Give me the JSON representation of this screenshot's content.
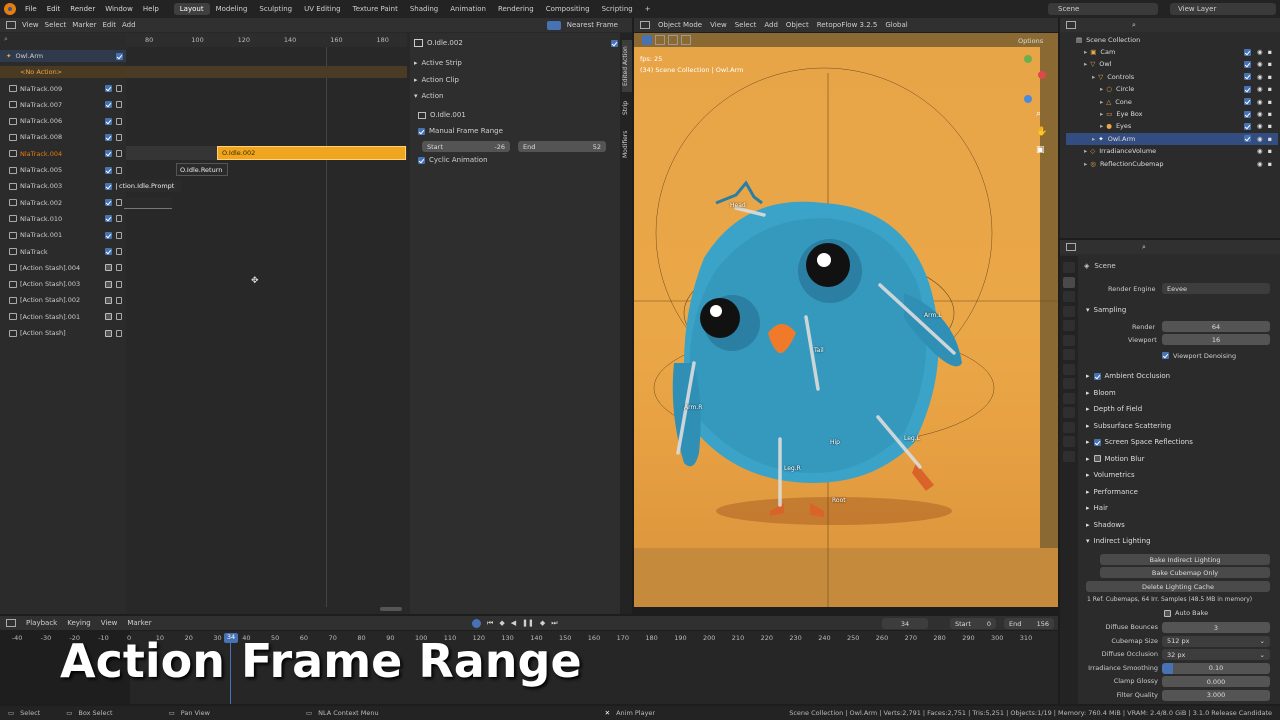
{
  "menu": {
    "file": "File",
    "edit": "Edit",
    "render": "Render",
    "window": "Window",
    "help": "Help"
  },
  "workspaces": [
    "Layout",
    "Modeling",
    "Sculpting",
    "UV Editing",
    "Texture Paint",
    "Shading",
    "Animation",
    "Rendering",
    "Compositing",
    "Scripting",
    "+"
  ],
  "scene_field": "Scene",
  "view_layer_field": "View Layer",
  "nla": {
    "header": {
      "view": "View",
      "select": "Select",
      "marker": "Marker",
      "edit": "Edit",
      "add": "Add",
      "snap": "Nearest Frame"
    },
    "ruler": [
      "80",
      "100",
      "120",
      "140",
      "160",
      "180"
    ],
    "object": "Owl.Arm",
    "no_action": "<No Action>",
    "tracks": [
      "NlaTrack.009",
      "NlaTrack.007",
      "NlaTrack.006",
      "NlaTrack.008",
      "NlaTrack.004",
      "NlaTrack.005",
      "NlaTrack.003",
      "NlaTrack.002",
      "NlaTrack.010",
      "NlaTrack.001",
      "NlaTrack",
      "[Action Stash].004",
      "[Action Stash].003",
      "[Action Stash].002",
      "[Action Stash].001",
      "[Action Stash]"
    ],
    "strips": {
      "active": "O.Idle.002",
      "return": "O.Idle.Return",
      "prompt": "ction.Idle.Prompt"
    }
  },
  "sidebar": {
    "title": "O.Idle.002",
    "active_strip": "Active Strip",
    "action_clip": "Action Clip",
    "action": "Action",
    "action_name": "O.Idle.001",
    "manual_range": "Manual Frame Range",
    "start_label": "Start",
    "start_value": "-26",
    "end_label": "End",
    "end_value": "52",
    "cyclic": "Cyclic Animation",
    "tabs": [
      "Edited Action",
      "Strip",
      "Modifiers"
    ]
  },
  "viewport": {
    "mode": "Object Mode",
    "view": "View",
    "select": "Select",
    "add": "Add",
    "object": "Object",
    "addon": "RetopoFlow 3.2.5",
    "orientation": "Global",
    "options": "Options",
    "fps": "fps: 25",
    "collection": "(34) Scene Collection | Owl.Arm",
    "bones": [
      "Head",
      "Arm.L",
      "Tail",
      "Arm.R",
      "Hip",
      "Leg.L",
      "Leg.R",
      "Root"
    ]
  },
  "outliner": {
    "header": "Scene Collection",
    "items": [
      "Cam",
      "Owl",
      "Controls",
      "Circle",
      "Cone",
      "Eye Box",
      "Eyes",
      "Owl.Arm",
      "IrradianceVolume",
      "ReflectionCubemap"
    ]
  },
  "properties": {
    "scene": "Scene",
    "render_engine_label": "Render Engine",
    "render_engine": "Eevee",
    "sampling": "Sampling",
    "render_label": "Render",
    "render_value": "64",
    "viewport_label": "Viewport",
    "viewport_value": "16",
    "viewport_denoising": "Viewport Denoising",
    "sections": [
      "Ambient Occlusion",
      "Bloom",
      "Depth of Field",
      "Subsurface Scattering",
      "Screen Space Reflections",
      "Motion Blur",
      "Volumetrics",
      "Performance",
      "Hair",
      "Shadows",
      "Indirect Lighting"
    ],
    "bake_indirect": "Bake Indirect Lighting",
    "bake_cubemap": "Bake Cubemap Only",
    "delete_cache": "Delete Lighting Cache",
    "cache_info": "1 Ref. Cubemaps, 64 Irr. Samples (48.5 MB in memory)",
    "auto_bake": "Auto Bake",
    "diffuse_bounces_label": "Diffuse Bounces",
    "diffuse_bounces": "3",
    "cubemap_size_label": "Cubemap Size",
    "cubemap_size": "512 px",
    "diffuse_occlusion_label": "Diffuse Occlusion",
    "diffuse_occlusion": "32 px",
    "irradiance_smoothing_label": "Irradiance Smoothing",
    "irradiance_smoothing": "0.10",
    "clamp_glossy_label": "Clamp Glossy",
    "clamp_glossy": "0.000",
    "filter_quality_label": "Filter Quality",
    "filter_quality": "3.000"
  },
  "timeline": {
    "playback": "Playback",
    "keying": "Keying",
    "view": "View",
    "marker": "Marker",
    "current": "34",
    "start_label": "Start",
    "start": "0",
    "end_label": "End",
    "end": "156",
    "ticks": [
      "-40",
      "-30",
      "-20",
      "-10",
      "0",
      "10",
      "20",
      "30",
      "34",
      "40",
      "50",
      "60",
      "70",
      "80",
      "90",
      "100",
      "110",
      "120",
      "130",
      "140",
      "150",
      "160",
      "170",
      "180",
      "190",
      "200",
      "210",
      "220",
      "230",
      "240",
      "250",
      "260",
      "270",
      "280",
      "290",
      "300",
      "310"
    ]
  },
  "caption": "Action Frame Range",
  "status": {
    "select": "Select",
    "box_select": "Box Select",
    "pan_view": "Pan View",
    "context": "NLA Context Menu",
    "anim_player": "Anim Player",
    "stats": "Scene Collection | Owl.Arm | Verts:2,791 | Faces:2,751 | Tris:5,251 | Objects:1/19 | Memory: 760.4 MiB | VRAM: 2.4/8.0 GiB | 3.1.0 Release Candidate"
  },
  "colors": {
    "accent": "#e87d0d",
    "selection": "#4772b3",
    "viewport_bg": "#e9a447"
  }
}
